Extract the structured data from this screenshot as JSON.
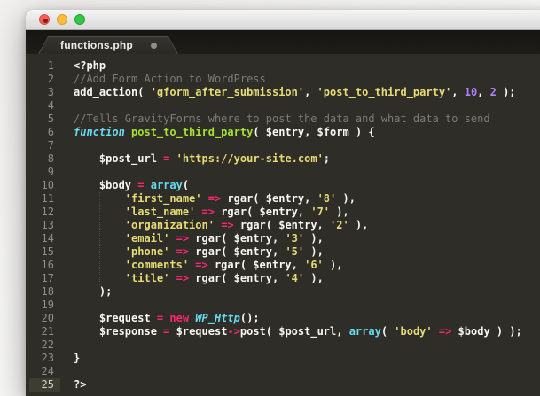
{
  "window": {
    "controls": [
      {
        "name": "close",
        "color": "#f95f57",
        "modified_dot": true
      },
      {
        "name": "minimize",
        "color": "#fbbd3c"
      },
      {
        "name": "zoom",
        "color": "#35c649"
      }
    ]
  },
  "tab": {
    "label": "functions.php",
    "modified": true
  },
  "colors": {
    "code_background": "#2e2d28",
    "tabbar_background": "#1a1916",
    "plain": "#f8f8f2",
    "comment": "#7c7c74",
    "string": "#e6db74",
    "keyword": "#f92672",
    "number": "#ae81ff",
    "builtin": "#66d9ef",
    "function_name": "#a6e22e",
    "line_number": "#8f8f89",
    "active_gutter": "#3e3d32"
  },
  "code": {
    "language": "php",
    "active_line": 25,
    "guides": [
      {
        "col": 0,
        "from": 7,
        "to": 22
      },
      {
        "col": 4,
        "from": 11,
        "to": 17
      }
    ],
    "lines": [
      {
        "n": 1,
        "tokens": [
          [
            "plain",
            "<?php"
          ]
        ]
      },
      {
        "n": 2,
        "tokens": [
          [
            "comment",
            "//Add Form Action to WordPress"
          ]
        ]
      },
      {
        "n": 3,
        "tokens": [
          [
            "plain",
            "add_action( "
          ],
          [
            "string",
            "'gform_after_submission'"
          ],
          [
            "plain",
            ", "
          ],
          [
            "string",
            "'post_to_third_party'"
          ],
          [
            "plain",
            ", "
          ],
          [
            "number",
            "10"
          ],
          [
            "plain",
            ", "
          ],
          [
            "number",
            "2"
          ],
          [
            "plain",
            " );"
          ]
        ]
      },
      {
        "n": 4,
        "tokens": []
      },
      {
        "n": 5,
        "tokens": [
          [
            "comment",
            "//Tells GravityForms where to post the data and what data to send"
          ]
        ]
      },
      {
        "n": 6,
        "tokens": [
          [
            "type",
            "function"
          ],
          [
            "plain",
            " "
          ],
          [
            "func",
            "post_to_third_party"
          ],
          [
            "plain",
            "( $entry, $form ) {"
          ]
        ]
      },
      {
        "n": 7,
        "tokens": []
      },
      {
        "n": 8,
        "tokens": [
          [
            "plain",
            "    $post_url "
          ],
          [
            "keyword",
            "="
          ],
          [
            "plain",
            " "
          ],
          [
            "string",
            "'https://your-site.com'"
          ],
          [
            "plain",
            ";"
          ]
        ]
      },
      {
        "n": 9,
        "tokens": []
      },
      {
        "n": 10,
        "tokens": [
          [
            "plain",
            "    $body "
          ],
          [
            "keyword",
            "="
          ],
          [
            "plain",
            " "
          ],
          [
            "support",
            "array"
          ],
          [
            "plain",
            "("
          ]
        ]
      },
      {
        "n": 11,
        "tokens": [
          [
            "plain",
            "        "
          ],
          [
            "string",
            "'first_name'"
          ],
          [
            "plain",
            " "
          ],
          [
            "keyword",
            "=>"
          ],
          [
            "plain",
            " rgar( $entry, "
          ],
          [
            "string",
            "'8'"
          ],
          [
            "plain",
            " ),"
          ]
        ]
      },
      {
        "n": 12,
        "tokens": [
          [
            "plain",
            "        "
          ],
          [
            "string",
            "'last_name'"
          ],
          [
            "plain",
            " "
          ],
          [
            "keyword",
            "=>"
          ],
          [
            "plain",
            " rgar( $entry, "
          ],
          [
            "string",
            "'7'"
          ],
          [
            "plain",
            " ),"
          ]
        ]
      },
      {
        "n": 13,
        "tokens": [
          [
            "plain",
            "        "
          ],
          [
            "string",
            "'organization'"
          ],
          [
            "plain",
            " "
          ],
          [
            "keyword",
            "=>"
          ],
          [
            "plain",
            " rgar( $entry, "
          ],
          [
            "string",
            "'2'"
          ],
          [
            "plain",
            " ),"
          ]
        ]
      },
      {
        "n": 14,
        "tokens": [
          [
            "plain",
            "        "
          ],
          [
            "string",
            "'email'"
          ],
          [
            "plain",
            " "
          ],
          [
            "keyword",
            "=>"
          ],
          [
            "plain",
            " rgar( $entry, "
          ],
          [
            "string",
            "'3'"
          ],
          [
            "plain",
            " ),"
          ]
        ]
      },
      {
        "n": 15,
        "tokens": [
          [
            "plain",
            "        "
          ],
          [
            "string",
            "'phone'"
          ],
          [
            "plain",
            " "
          ],
          [
            "keyword",
            "=>"
          ],
          [
            "plain",
            " rgar( $entry, "
          ],
          [
            "string",
            "'5'"
          ],
          [
            "plain",
            " ),"
          ]
        ]
      },
      {
        "n": 16,
        "tokens": [
          [
            "plain",
            "        "
          ],
          [
            "string",
            "'comments'"
          ],
          [
            "plain",
            " "
          ],
          [
            "keyword",
            "=>"
          ],
          [
            "plain",
            " rgar( $entry, "
          ],
          [
            "string",
            "'6'"
          ],
          [
            "plain",
            " ),"
          ]
        ]
      },
      {
        "n": 17,
        "tokens": [
          [
            "plain",
            "        "
          ],
          [
            "string",
            "'title'"
          ],
          [
            "plain",
            " "
          ],
          [
            "keyword",
            "=>"
          ],
          [
            "plain",
            " rgar( $entry, "
          ],
          [
            "string",
            "'4'"
          ],
          [
            "plain",
            " ),"
          ]
        ]
      },
      {
        "n": 18,
        "tokens": [
          [
            "plain",
            "    );"
          ]
        ]
      },
      {
        "n": 19,
        "tokens": []
      },
      {
        "n": 20,
        "tokens": [
          [
            "plain",
            "    $request "
          ],
          [
            "keyword",
            "="
          ],
          [
            "plain",
            " "
          ],
          [
            "keyword",
            "new"
          ],
          [
            "plain",
            " "
          ],
          [
            "type",
            "WP_Http"
          ],
          [
            "plain",
            "();"
          ]
        ]
      },
      {
        "n": 21,
        "tokens": [
          [
            "plain",
            "    $response "
          ],
          [
            "keyword",
            "="
          ],
          [
            "plain",
            " $request"
          ],
          [
            "keyword",
            "->"
          ],
          [
            "plain",
            "post( $post_url, "
          ],
          [
            "support",
            "array"
          ],
          [
            "plain",
            "( "
          ],
          [
            "string",
            "'body'"
          ],
          [
            "plain",
            " "
          ],
          [
            "keyword",
            "=>"
          ],
          [
            "plain",
            " $body ) );"
          ]
        ]
      },
      {
        "n": 22,
        "tokens": []
      },
      {
        "n": 23,
        "tokens": [
          [
            "plain",
            "}"
          ]
        ]
      },
      {
        "n": 24,
        "tokens": []
      },
      {
        "n": 25,
        "tokens": [
          [
            "plain",
            "?>"
          ]
        ]
      }
    ]
  }
}
